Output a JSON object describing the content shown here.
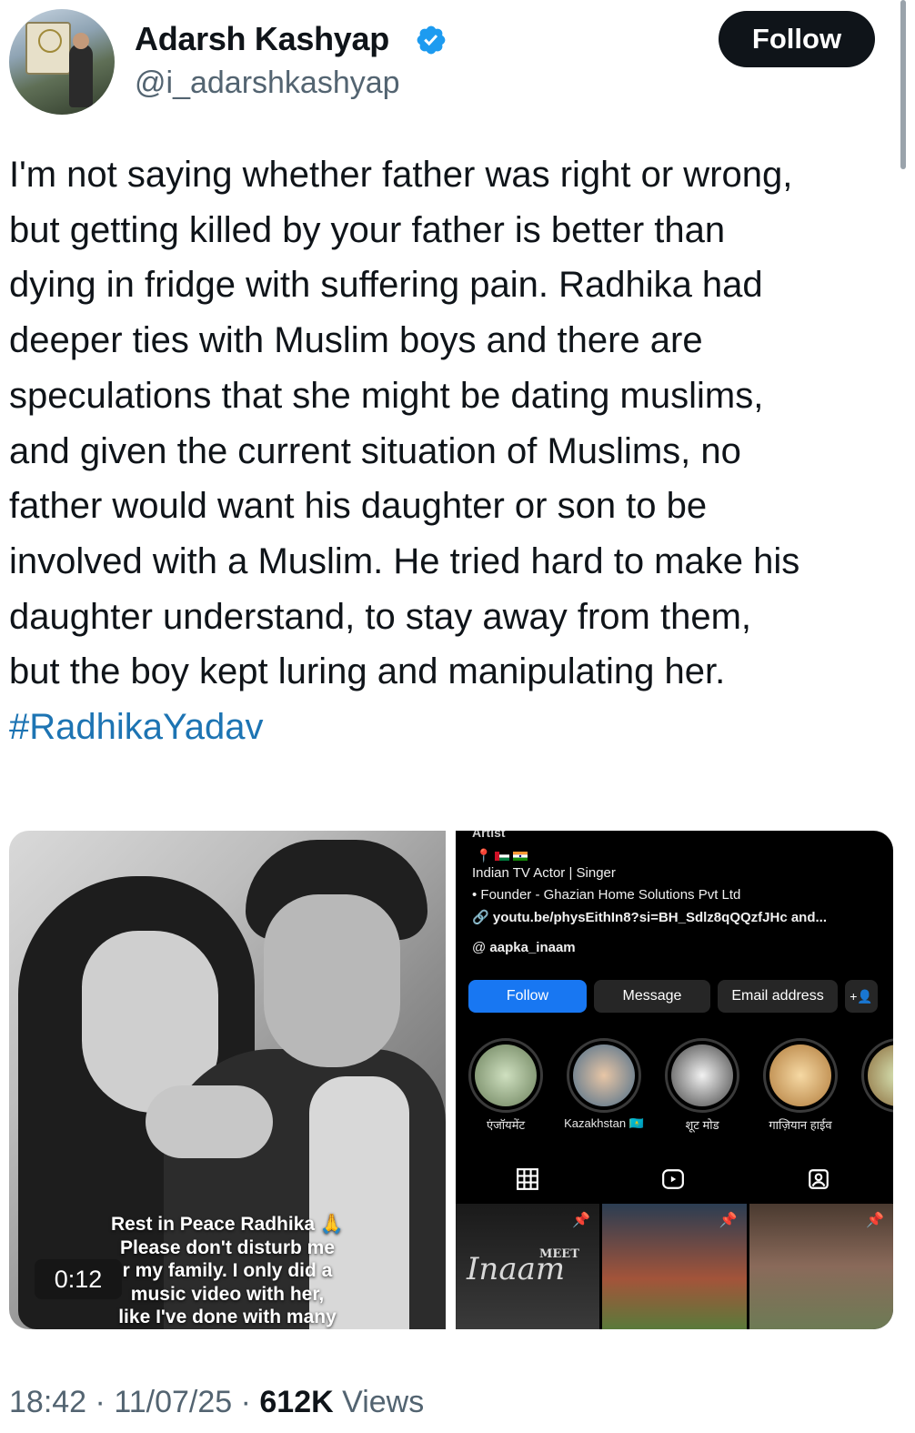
{
  "header": {
    "display_name": "Adarsh Kashyap",
    "handle": "@i_adarshkashyap",
    "follow_label": "Follow",
    "verified_icon": "verified-badge-icon",
    "verified_color": "#1d9bf0"
  },
  "tweet": {
    "lines": [
      "I'm not saying whether father was right or wrong,",
      "but getting killed by your father is better than",
      "dying in fridge with suffering pain. Radhika had",
      "deeper ties with Muslim boys and there are",
      "speculations that she might be dating muslims,",
      "and given the current situation of Muslims, no",
      "father would want his daughter or son to be",
      "involved with a Muslim. He tried hard to make his",
      "daughter understand, to stay away from them,",
      "but the boy kept luring and manipulating her."
    ],
    "hashtag": "#RadhikaYadav",
    "hashtag_color": "#1d74b3"
  },
  "video": {
    "timer": "0:12",
    "caption_lines": [
      "Rest in Peace Radhika 🙏",
      "Please don't disturb me",
      "r my family. I only did a",
      "music video with her,",
      "like I've done with many"
    ]
  },
  "instagram": {
    "artist_label": "Artist",
    "bio_line1": "Indian TV Actor | Singer",
    "bio_line2": "• Founder - Ghazian Home Solutions Pvt Ltd",
    "bio_link": "youtu.be/physEithIn8?si=BH_Sdlz8qQQzfJHc and...",
    "threads_handle": "aapka_inaam",
    "buttons": {
      "follow": "Follow",
      "message": "Message",
      "email": "Email address",
      "add_person": "+👤"
    },
    "highlights": [
      "एंजॉयमेंट",
      "Kazakhstan 🇰🇿",
      "शूट मोड",
      "गाज़ियान हाईव",
      ""
    ],
    "grid_texts": {
      "inaam": "Inaam",
      "meet": "MEET"
    },
    "accent_color": "#1877f2"
  },
  "meta": {
    "time": "18:42",
    "date": "11/07/25",
    "views_count": "612K",
    "views_label": "Views",
    "separator": "·"
  }
}
